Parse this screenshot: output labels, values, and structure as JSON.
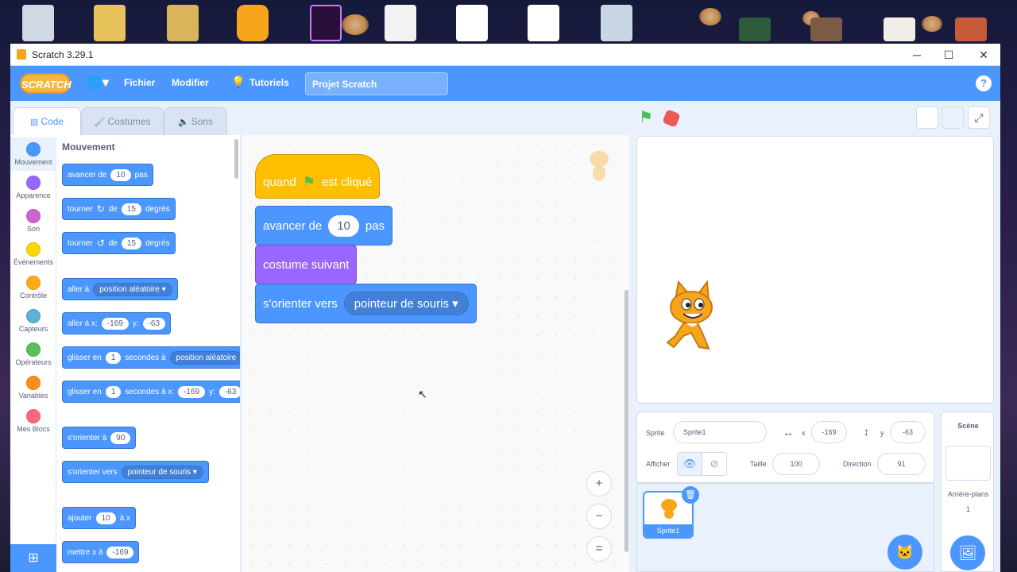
{
  "window": {
    "title": "Scratch 3.29.1",
    "minimize": "─",
    "maximize": "☐",
    "close": "✕"
  },
  "menubar": {
    "logo": "SCRATCH",
    "file": "Fichier",
    "edit": "Modifier",
    "tutorials": "Tutoriels",
    "project_name": "Projet Scratch",
    "help": "?"
  },
  "tabs": {
    "code": "Code",
    "costumes": "Costumes",
    "sounds": "Sons"
  },
  "categories": [
    {
      "label": "Mouvement",
      "color": "#4c97ff"
    },
    {
      "label": "Apparence",
      "color": "#9966ff"
    },
    {
      "label": "Son",
      "color": "#cf63cf"
    },
    {
      "label": "Événements",
      "color": "#ffd500"
    },
    {
      "label": "Contrôle",
      "color": "#ffab19"
    },
    {
      "label": "Capteurs",
      "color": "#5cb1d6"
    },
    {
      "label": "Opérateurs",
      "color": "#59c059"
    },
    {
      "label": "Variables",
      "color": "#ff8c1a"
    },
    {
      "label": "Mes Blocs",
      "color": "#ff6680"
    }
  ],
  "palette": {
    "title": "Mouvement",
    "b1": {
      "a": "avancer de",
      "v": "10",
      "b": "pas"
    },
    "b2": {
      "a": "tourner",
      "icon": "↻",
      "b": "de",
      "v": "15",
      "c": "degrés"
    },
    "b3": {
      "a": "tourner",
      "icon": "↺",
      "b": "de",
      "v": "15",
      "c": "degrés"
    },
    "b4": {
      "a": "aller à",
      "dd": "position aléatoire ▾"
    },
    "b5": {
      "a": "aller à x:",
      "x": "-169",
      "b": "y:",
      "y": "-63"
    },
    "b6": {
      "a": "glisser en",
      "v": "1",
      "b": "secondes à",
      "dd": "position aléatoire"
    },
    "b7": {
      "a": "glisser en",
      "v": "1",
      "b": "secondes à x:",
      "x": "-169",
      "c": "y:",
      "y": "-63"
    },
    "b8": {
      "a": "s'orienter à",
      "v": "90"
    },
    "b9": {
      "a": "s'orienter vers",
      "dd": "pointeur de souris ▾"
    },
    "b10": {
      "a": "ajouter",
      "v": "10",
      "b": "à x"
    },
    "b11": {
      "a": "mettre x à",
      "v": "-169"
    }
  },
  "script": {
    "hat": {
      "a": "quand",
      "b": "est cliqué"
    },
    "move": {
      "a": "avancer de",
      "v": "10",
      "b": "pas"
    },
    "costume": "costume suivant",
    "point": {
      "a": "s'orienter vers",
      "dd": "pointeur de souris ▾"
    }
  },
  "zoom": {
    "in": "+",
    "out": "−",
    "reset": "="
  },
  "sprite_info": {
    "sprite_label": "Sprite",
    "sprite_name": "Sprite1",
    "x_label": "x",
    "x": "-169",
    "y_label": "y",
    "y": "-63",
    "show_label": "Afficher",
    "size_label": "Taille",
    "size": "100",
    "direction_label": "Direction",
    "direction": "91"
  },
  "sprite_list": [
    {
      "name": "Sprite1"
    }
  ],
  "scene": {
    "title": "Scène",
    "backdrops_label": "Arrière-plans",
    "backdrops_count": "1"
  },
  "colors": {
    "accent": "#4c97ff",
    "motion": "#4c97ff",
    "looks": "#9966ff",
    "events": "#ffbf00"
  }
}
